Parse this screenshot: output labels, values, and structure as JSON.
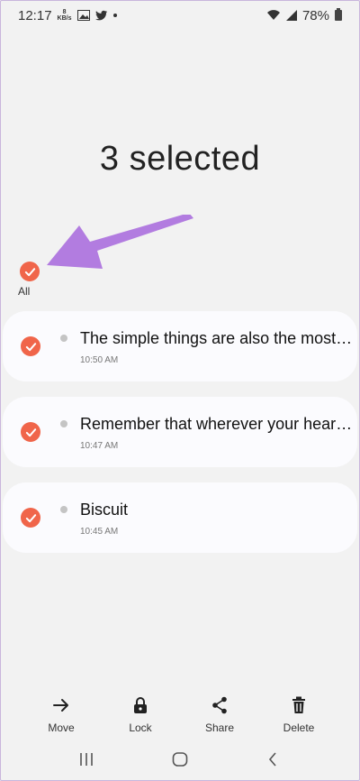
{
  "status_bar": {
    "time": "12:17",
    "speed_value": "8",
    "speed_unit": "KB/s",
    "battery": "78%",
    "icons": [
      "image-icon",
      "twitter-icon",
      "wifi-icon",
      "signal-icon",
      "battery-icon"
    ]
  },
  "header": {
    "title": "3 selected"
  },
  "select_all": {
    "label": "All"
  },
  "notes": [
    {
      "text": "The simple things are also the most…",
      "time": "10:50 AM"
    },
    {
      "text": "Remember that wherever your hear…",
      "time": "10:47 AM"
    },
    {
      "text": "Biscuit",
      "time": "10:45 AM"
    }
  ],
  "toolbar": {
    "move": "Move",
    "lock": "Lock",
    "share": "Share",
    "delete": "Delete"
  },
  "colors": {
    "accent": "#f0654a",
    "arrow": "#b27ce0",
    "background": "#f2f2f2"
  }
}
